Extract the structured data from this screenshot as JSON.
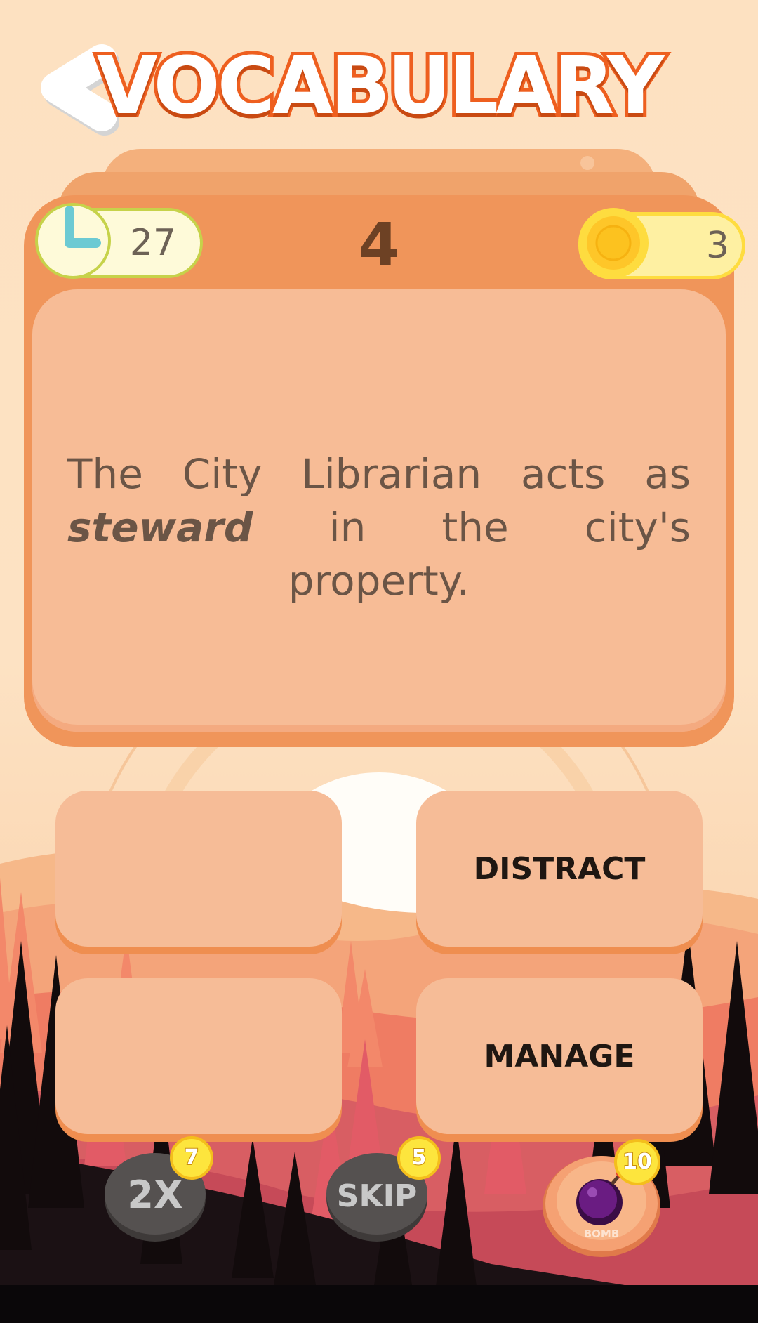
{
  "header": {
    "title": "VOCABULARY",
    "back_icon": "back-arrow-icon"
  },
  "status": {
    "timer": "27",
    "level": "4",
    "coins": "3"
  },
  "question": {
    "before": "The City Librarian acts as",
    "keyword": "steward",
    "after": "in the city's property."
  },
  "answers": [
    {
      "label": ""
    },
    {
      "label": "DISTRACT"
    },
    {
      "label": ""
    },
    {
      "label": "MANAGE"
    }
  ],
  "powerups": [
    {
      "name": "double",
      "label": "2X",
      "cost": "7"
    },
    {
      "name": "skip",
      "label": "SKIP",
      "cost": "5"
    },
    {
      "name": "bomb",
      "label": "BOMB",
      "cost": "10"
    }
  ],
  "colors": {
    "accent": "#ee5f1f",
    "card": "#f0955a",
    "panel": "#f7bc96",
    "coin": "#fedc3f",
    "timer_icon": "#6ccad3"
  }
}
